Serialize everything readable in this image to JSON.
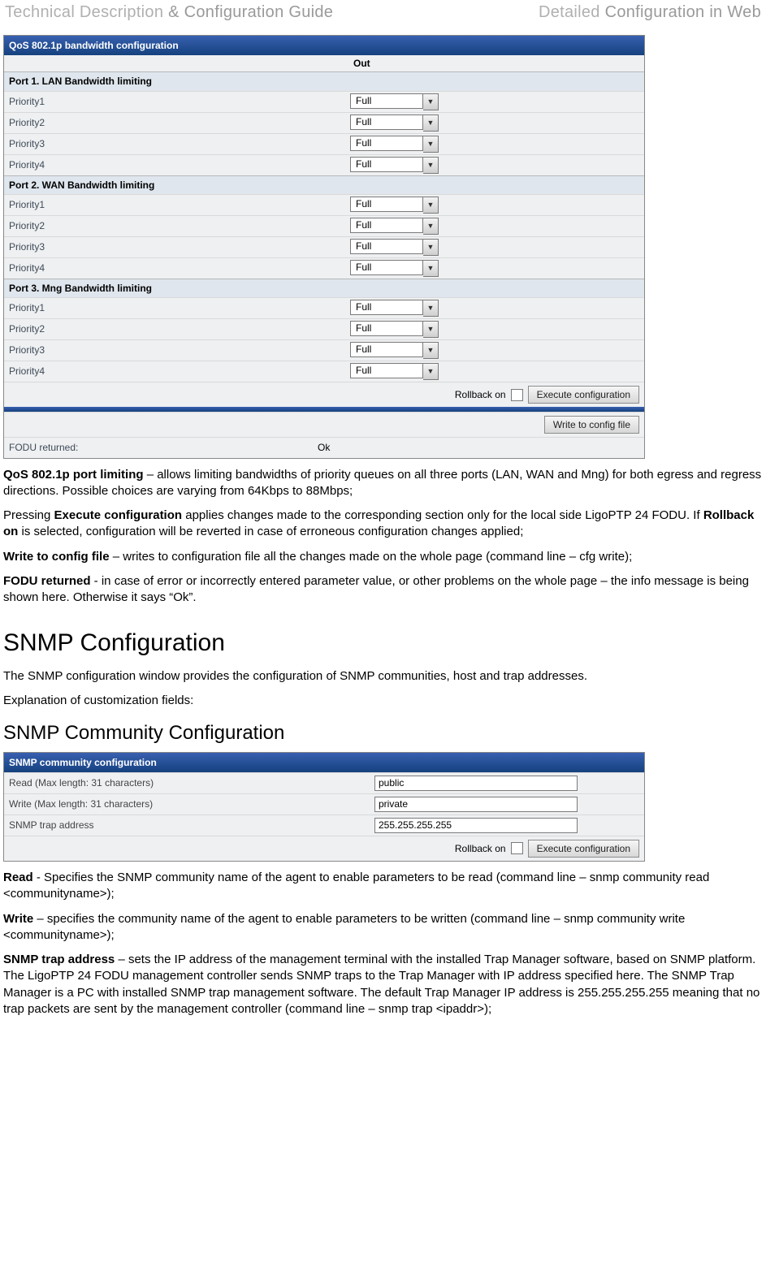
{
  "page_header": {
    "left_a": "Technical Description",
    "left_b": " & Configuration Guide",
    "right_a": "Detailed ",
    "right_b": "Configuration in Web"
  },
  "qos": {
    "title": "QoS 802.1p bandwidth configuration",
    "out_label": "Out",
    "port1": {
      "hdr": "Port 1. LAN Bandwidth limiting",
      "p1": "Priority1",
      "p2": "Priority2",
      "p3": "Priority3",
      "p4": "Priority4",
      "v": "Full"
    },
    "port2": {
      "hdr": "Port 2. WAN Bandwidth limiting",
      "p1": "Priority1",
      "p2": "Priority2",
      "p3": "Priority3",
      "p4": "Priority4",
      "v": "Full"
    },
    "port3": {
      "hdr": "Port 3. Mng Bandwidth limiting",
      "p1": "Priority1",
      "p2": "Priority2",
      "p3": "Priority3",
      "p4": "Priority4",
      "v": "Full"
    },
    "rollback": "Rollback on",
    "exec": "Execute configuration",
    "write": "Write to config file",
    "fodu_label": "FODU returned:",
    "fodu_value": "Ok"
  },
  "text": {
    "p1_a": "QoS 802.1p port limiting",
    "p1_b": " – allows limiting bandwidths of priority queues on all three ports (LAN, WAN and Mng) for both egress and regress directions. Possible choices are varying from 64Kbps to 88Mbps;",
    "p2_a": "Pressing ",
    "p2_b": "Execute configuration",
    "p2_c": " applies changes made to the corresponding section only for the local side LigoPTP 24 FODU. If ",
    "p2_d": "Rollback on",
    "p2_e": " is selected, configuration will be reverted in case of erroneous configuration changes applied;",
    "p3_a": "Write to config file",
    "p3_b": " – writes to configuration file all the changes made on the whole page (command line – cfg write);",
    "p4_a": "FODU returned",
    "p4_b": " - in case of error or incorrectly entered parameter value, or other problems on the whole page – the info message is being shown here. Otherwise it says “Ok”."
  },
  "h2": "SNMP Configuration",
  "snmp_intro": "The SNMP configuration window provides the configuration of SNMP communities, host and trap addresses.",
  "snmp_expl": "Explanation of customization fields:",
  "h3": "SNMP Community Configuration",
  "snmp": {
    "title": "SNMP community configuration",
    "read_lab": "Read (Max length: 31 characters)",
    "write_lab": "Write (Max length: 31 characters)",
    "trap_lab": "SNMP trap address",
    "read_val": "public",
    "write_val": "private",
    "trap_val": "255.255.255.255",
    "rollback": "Rollback on",
    "exec": "Execute configuration"
  },
  "text2": {
    "r_a": "Read",
    "r_b": " - Specifies the SNMP community name of the agent to enable parameters to be read (command line – snmp community read <communityname>);",
    "w_a": "Write",
    "w_b": " – specifies the community name of the agent to enable parameters to be written (command line – snmp community write <communityname>);",
    "t_a": "SNMP trap address",
    "t_b": " – sets the IP address of the management terminal with the installed Trap Manager software, based on SNMP platform. The LigoPTP 24 FODU management controller sends SNMP traps to the Trap Manager with IP address specified here. The SNMP Trap Manager is a PC with installed SNMP trap management software. The default Trap Manager IP address is 255.255.255.255 meaning that no trap packets are sent by the management controller (command line – snmp trap <ipaddr>);"
  }
}
